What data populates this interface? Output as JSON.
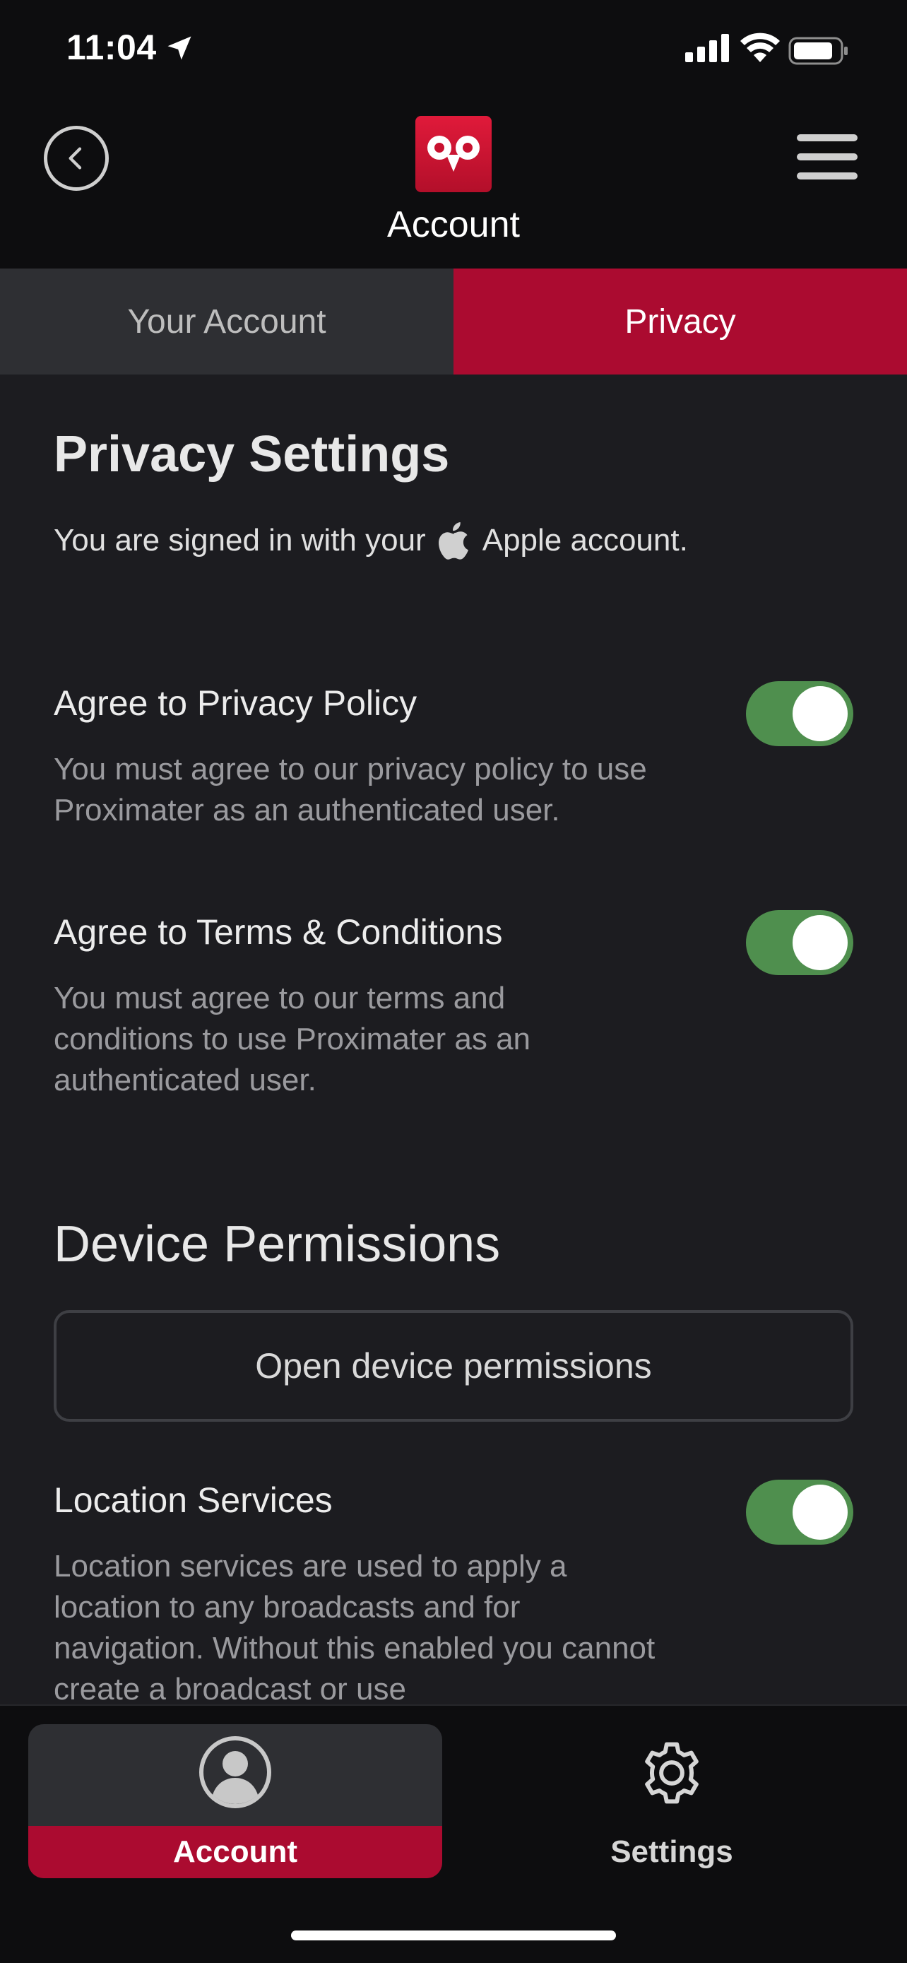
{
  "status_bar": {
    "time": "11:04"
  },
  "header": {
    "title": "Account"
  },
  "tabs": [
    {
      "label": "Your Account",
      "active": false
    },
    {
      "label": "Privacy",
      "active": true
    }
  ],
  "privacy": {
    "title": "Privacy Settings",
    "signed_in_prefix": "You are signed in with your",
    "signed_in_suffix": "Apple account.",
    "settings": [
      {
        "label": "Agree to Privacy Policy",
        "description": "You must agree to our privacy policy to use Proximater as an authenticated user.",
        "enabled": true
      },
      {
        "label": "Agree to Terms & Conditions",
        "description": "You must agree to our terms and conditions to use Proximater as an authenticated user.",
        "enabled": true
      }
    ]
  },
  "device_permissions": {
    "title": "Device Permissions",
    "open_button": "Open device permissions",
    "settings": [
      {
        "label": "Location Services",
        "description": "Location services are used to apply a location to any broadcasts and for navigation. Without this enabled you cannot create a broadcast or use",
        "enabled": true
      }
    ]
  },
  "bottom_nav": {
    "items": [
      {
        "label": "Account",
        "active": true,
        "icon": "user-avatar-icon"
      },
      {
        "label": "Settings",
        "active": false,
        "icon": "gear-icon"
      }
    ]
  },
  "colors": {
    "accent": "#ab0b30",
    "toggle_on": "#4f8f4e",
    "background": "#1c1c20",
    "header_bg": "#0d0d0f"
  }
}
